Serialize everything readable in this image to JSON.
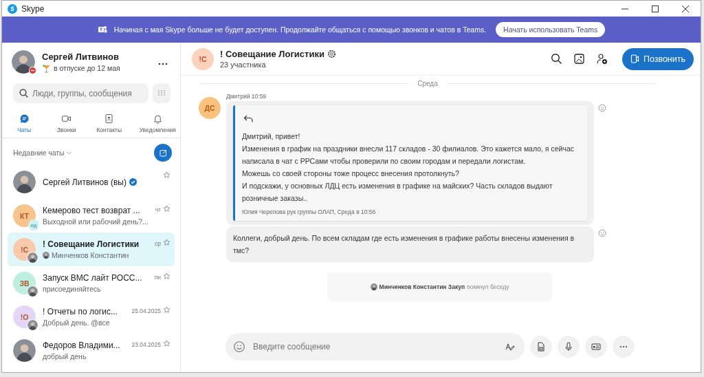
{
  "window": {
    "title": "Skype"
  },
  "banner": {
    "text": "Начиная с мая Skype больше не будет доступен. Продолжайте общаться с помощью звонков и чатов в Teams.",
    "button": "Начать использовать Teams"
  },
  "profile": {
    "name": "Сергей Литвинов",
    "status": "в отпуске до 12 мая"
  },
  "search": {
    "placeholder": "Люди, группы, сообщения"
  },
  "nav_tabs": [
    {
      "label": "Чаты",
      "kind": "chat",
      "selected": true
    },
    {
      "label": "Звонки",
      "kind": "calls",
      "selected": false
    },
    {
      "label": "Контакты",
      "kind": "contacts",
      "selected": false
    },
    {
      "label": "Уведомления",
      "kind": "bell",
      "selected": false
    }
  ],
  "recent_header": "Недавние чаты",
  "chats": [
    {
      "title": "Сергей Литвинов (вы)",
      "verified": true,
      "avatar": {
        "kind": "photo"
      },
      "selected": false
    },
    {
      "title": "Кемерово тест возврат ...",
      "preview": "Выходной или рабочий день?...",
      "time": "чт",
      "avatar": {
        "kind": "initials",
        "initials": "КТ",
        "color": "#f7c48e"
      },
      "sub": {
        "kind": "initials",
        "initials": "юд"
      },
      "selected": false
    },
    {
      "title": "! Совещание Логистики",
      "preview": "Минченков Константин",
      "preview_photo": true,
      "time": "ср",
      "avatar": {
        "kind": "initials",
        "initials": "!С",
        "color": "#f9c9ae"
      },
      "sub": {
        "kind": "photo"
      },
      "selected": true
    },
    {
      "title": "Запуск ВМС лайт РОСС...",
      "preview": "присоединяйтесь",
      "time": "пн",
      "avatar": {
        "kind": "initials",
        "initials": "ЗВ",
        "color": "#bdeee0"
      },
      "sub": {
        "kind": "photo"
      },
      "selected": false
    },
    {
      "title": "! Отчеты по логис...",
      "preview": "Добрый день. @все",
      "time": "25.04.2025",
      "avatar": {
        "kind": "initials",
        "initials": "!О",
        "color": "#e4d6f5"
      },
      "sub": {
        "kind": "photo"
      },
      "selected": false
    },
    {
      "title": "Федоров Владими...",
      "preview": "добрый день",
      "time": "23.04.2025",
      "avatar": {
        "kind": "photo"
      },
      "selected": false
    }
  ],
  "conversation": {
    "initials": "!С",
    "title": "! Совещание Логистики",
    "subtitle": "23 участника",
    "call_button": "Позвонить"
  },
  "day_divider": "Среда",
  "message_group": {
    "initials": "ДС",
    "author_time": "Дмитрий 10:59",
    "quote": {
      "text": "Дмитрий, привет!\nИзменения в график на праздники внесли 117 складов - 30 филиалов. Это кажется мало, я сейчас написала в чат с РРСами чтобы проверили по своим городам и передали логистам.\nМожешь со своей стороны тоже процесс внесения протолкнуть?\nИ подскажи, у основных ЛДЦ есть изменения в графике на майских? Часть складов выдают розничные заказы..",
      "attribution": "Юлия Черепова рук группы ОЛАП, Среда в 10:56"
    },
    "message": "Коллеги, добрый день. По всем складам где есть изменения в графике работы внесены изменения в тмс?"
  },
  "system_notice": {
    "person": "Минченков Константин Закуп",
    "action": "покинул беседу"
  },
  "composer": {
    "placeholder": "Введите сообщение"
  }
}
